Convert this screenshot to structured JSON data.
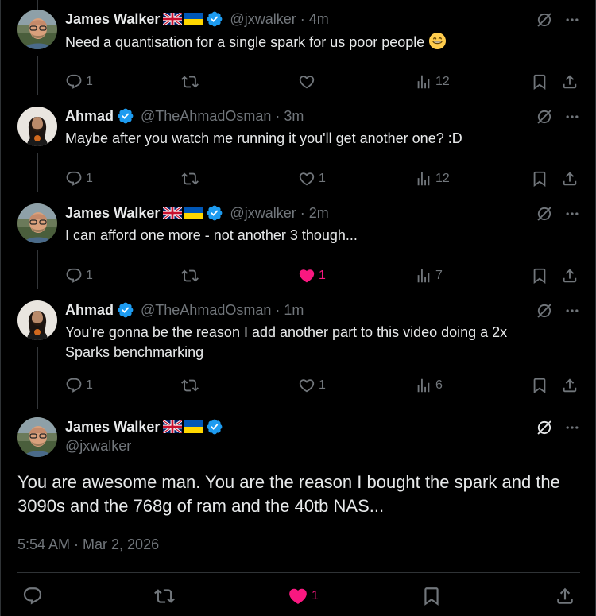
{
  "replies": [
    {
      "name": "James Walker",
      "handle": "@jxwalker",
      "time": "4m",
      "text": "Need a quantisation for a single spark for us poor people",
      "emoji": "grinning-face-emoji",
      "replies": "1",
      "retweets": "",
      "likes": "",
      "liked": false,
      "views": "12",
      "avatar": "james-avatar"
    },
    {
      "name": "Ahmad",
      "handle": "@TheAhmadOsman",
      "time": "3m",
      "text": "Maybe after you watch me running it you'll get another one? :D",
      "replies": "1",
      "retweets": "",
      "likes": "1",
      "liked": false,
      "views": "12",
      "avatar": "ahmad-avatar"
    },
    {
      "name": "James Walker",
      "handle": "@jxwalker",
      "time": "2m",
      "text": "I can afford one more - not another 3 though...",
      "replies": "1",
      "retweets": "",
      "likes": "1",
      "liked": true,
      "views": "7",
      "avatar": "james-avatar"
    },
    {
      "name": "Ahmad",
      "handle": "@TheAhmadOsman",
      "time": "1m",
      "text": "You're gonna be the reason I add another part to this video doing a 2x Sparks benchmarking",
      "replies": "1",
      "retweets": "",
      "likes": "1",
      "liked": false,
      "views": "6",
      "avatar": "ahmad-avatar"
    }
  ],
  "main_tweet": {
    "name": "James Walker",
    "handle": "@jxwalker",
    "text": "You are awesome man. You are the reason I bought the spark and the 3090s and the 768g of ram and the 40tb NAS...",
    "timestamp": "5:54 AM · Mar 2, 2026",
    "likes": "1",
    "liked": true
  },
  "icons": {
    "flags": [
      "uk-flag-icon",
      "ukraine-flag-icon"
    ],
    "verified": "verified-badge-icon",
    "grok": "grok-icon",
    "more": "more-icon",
    "reply": "reply-icon",
    "retweet": "retweet-icon",
    "like": "heart-icon",
    "views": "views-icon",
    "bookmark": "bookmark-icon",
    "share": "share-icon"
  },
  "colors": {
    "background": "#000000",
    "text": "#e7e9ea",
    "muted": "#71767b",
    "verified": "#1d9bf0",
    "like": "#f91880",
    "divider": "#2f3336"
  }
}
